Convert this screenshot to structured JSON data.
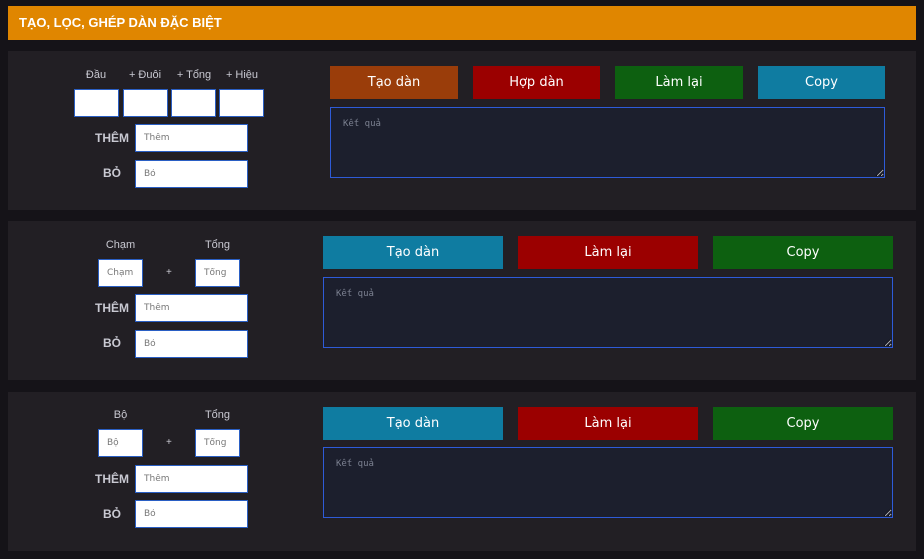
{
  "header": {
    "title": "TẠO, LỌC, GHÉP DÀN ĐẶC BIỆT"
  },
  "panel1": {
    "labels": {
      "dau": "Đầu",
      "duoi": "+ Đuôi",
      "tong": "+ Tổng",
      "hieu": "+ Hiệu"
    },
    "them_label": "THÊM",
    "bo_label": "BỎ",
    "them_placeholder": "Thêm",
    "bo_placeholder": "Bỏ",
    "buttons": {
      "tao": "Tạo dàn",
      "hop": "Hợp dàn",
      "lamlai": "Làm lại",
      "copy": "Copy"
    },
    "result_placeholder": "Kết quả",
    "colors": {
      "tao": "#9a3d0a",
      "hop": "#9b0000",
      "lamlai": "#0d6010",
      "copy": "#0f7ca1"
    }
  },
  "panel2": {
    "labels": {
      "left": "Chạm",
      "right": "Tổng"
    },
    "plus": "+",
    "left_placeholder": "Chạm",
    "right_placeholder": "Tổng",
    "them_label": "THÊM",
    "bo_label": "BỎ",
    "them_placeholder": "Thêm",
    "bo_placeholder": "Bỏ",
    "buttons": {
      "tao": "Tạo dàn",
      "lamlai": "Làm lại",
      "copy": "Copy"
    },
    "result_placeholder": "Kết quả",
    "colors": {
      "tao": "#0f7ca1",
      "lamlai": "#9b0000",
      "copy": "#0d6010"
    }
  },
  "panel3": {
    "labels": {
      "left": "Bộ",
      "right": "Tổng"
    },
    "plus": "+",
    "left_placeholder": "Bộ",
    "right_placeholder": "Tổng",
    "them_label": "THÊM",
    "bo_label": "BỎ",
    "them_placeholder": "Thêm",
    "bo_placeholder": "Bỏ",
    "buttons": {
      "tao": "Tạo dàn",
      "lamlai": "Làm lại",
      "copy": "Copy"
    },
    "result_placeholder": "Kết quả",
    "colors": {
      "tao": "#0f7ca1",
      "lamlai": "#9b0000",
      "copy": "#0d6010"
    }
  }
}
